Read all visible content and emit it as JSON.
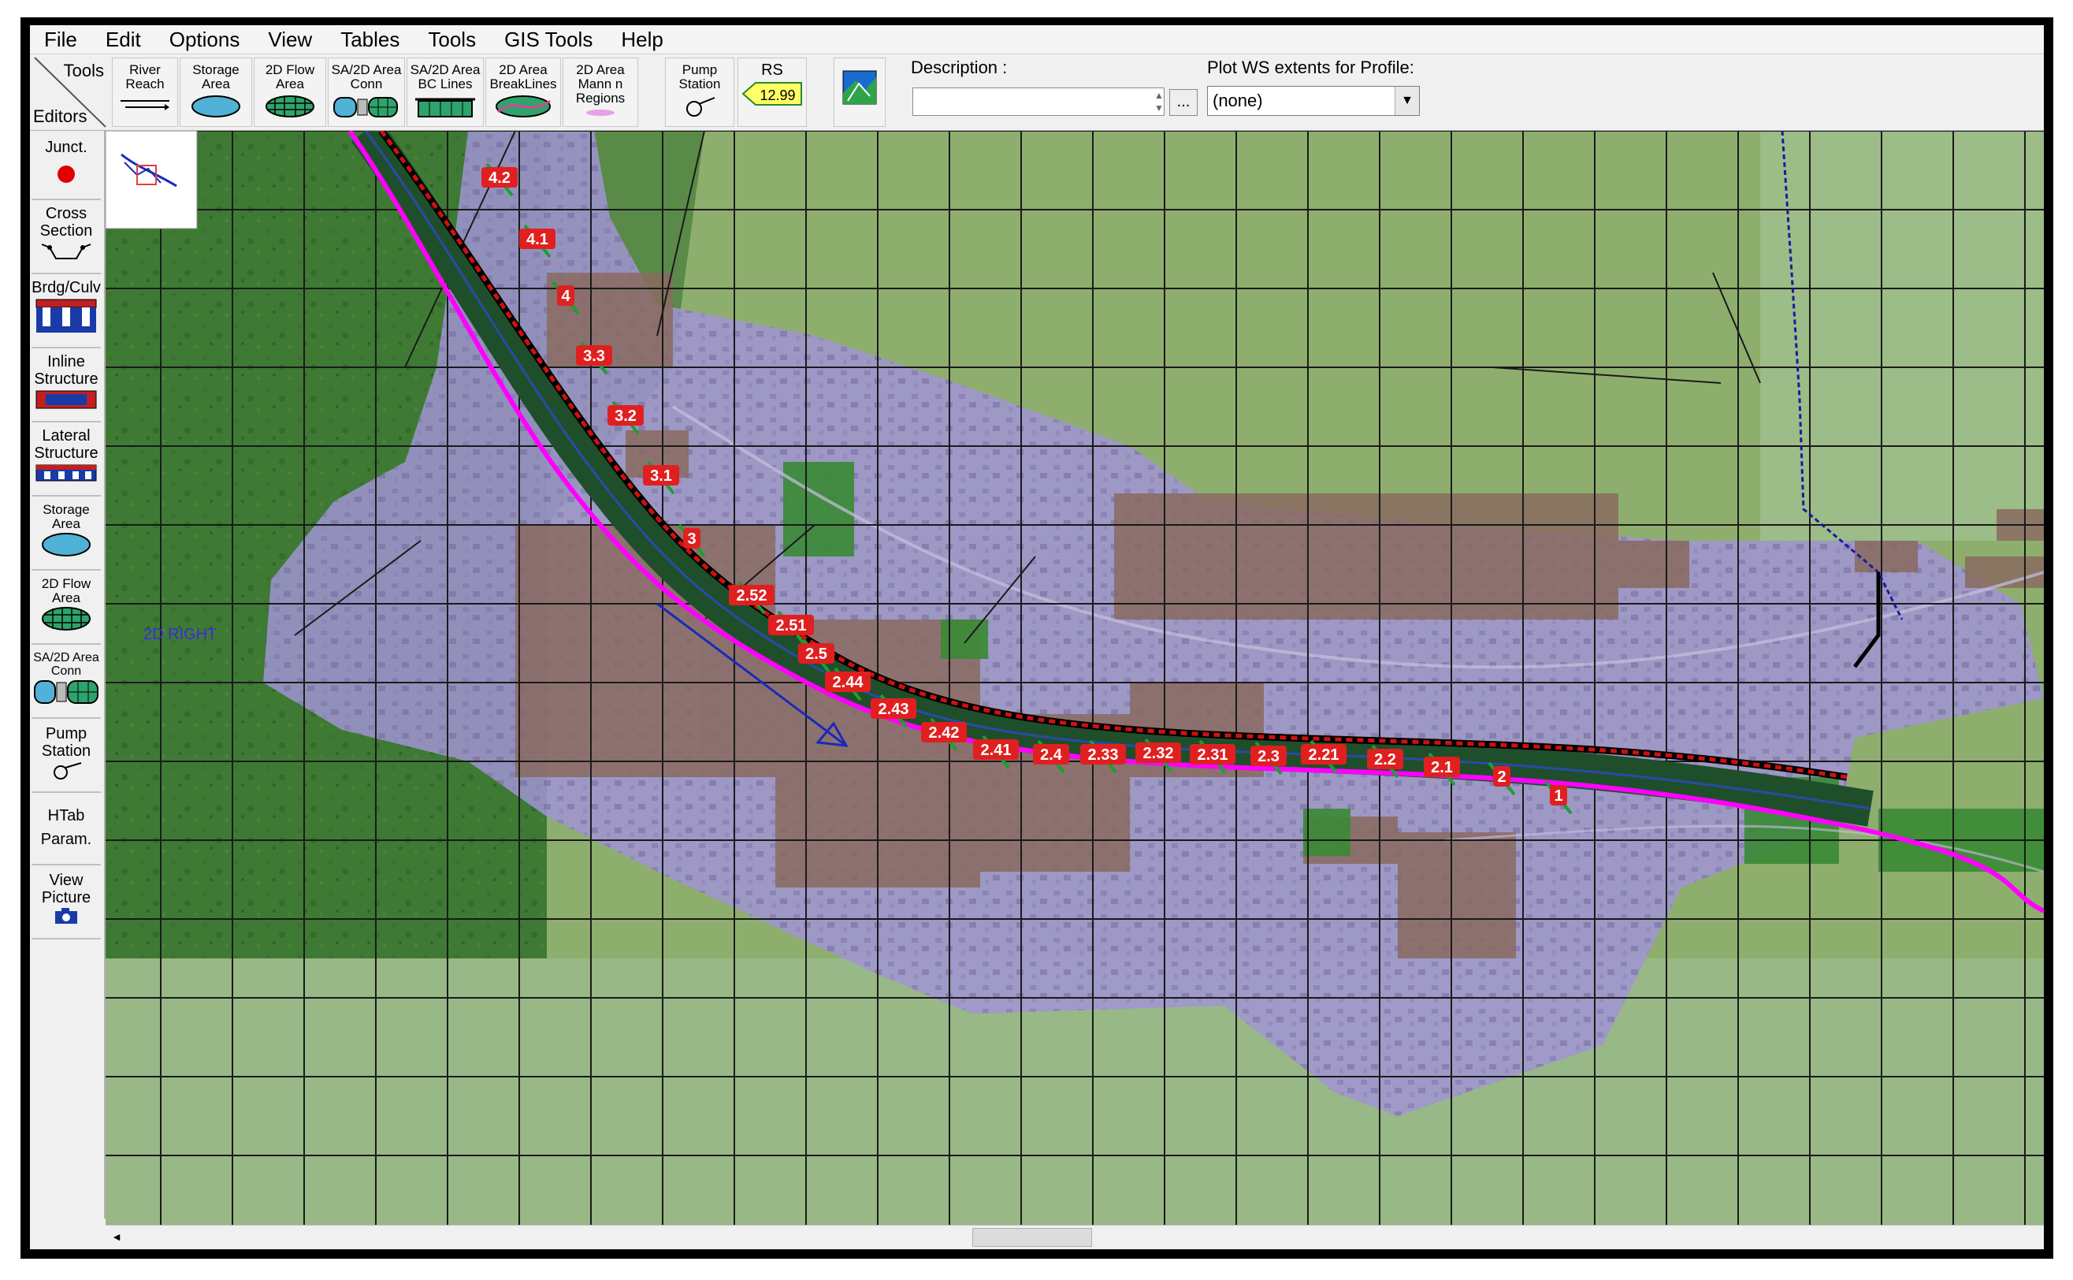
{
  "menu": [
    "File",
    "Edit",
    "Options",
    "View",
    "Tables",
    "Tools",
    "GIS Tools",
    "Help"
  ],
  "toolbar": {
    "corner_tools": "Tools",
    "corner_editors": "Editors",
    "buttons": [
      {
        "l1": "River",
        "l2": "Reach"
      },
      {
        "l1": "Storage",
        "l2": "Area"
      },
      {
        "l1": "2D Flow",
        "l2": "Area"
      },
      {
        "l1": "SA/2D Area",
        "l2": "Conn"
      },
      {
        "l1": "SA/2D Area",
        "l2": "BC Lines"
      },
      {
        "l1": "2D Area",
        "l2": "BreakLines"
      },
      {
        "l1": "2D Area",
        "l2": "Mann n Regions"
      },
      {
        "l1": "Pump",
        "l2": "Station"
      },
      {
        "l1": "RS",
        "l2": "12.99"
      }
    ],
    "description_label": "Description :",
    "description_value": "",
    "dots": "...",
    "plot_label": "Plot WS extents for Profile:",
    "plot_value": "(none)"
  },
  "editors": [
    {
      "l1": "Junct.",
      "l2": ""
    },
    {
      "l1": "Cross",
      "l2": "Section"
    },
    {
      "l1": "Brdg/Culv",
      "l2": ""
    },
    {
      "l1": "Inline",
      "l2": "Structure"
    },
    {
      "l1": "Lateral",
      "l2": "Structure"
    },
    {
      "l1": "Storage",
      "l2": "Area"
    },
    {
      "l1": "2D Flow",
      "l2": "Area"
    },
    {
      "l1": "SA/2D Area",
      "l2": "Conn"
    },
    {
      "l1": "Pump",
      "l2": "Station"
    },
    {
      "l1": "HTab",
      "l2": "Param."
    },
    {
      "l1": "View",
      "l2": "Picture"
    }
  ],
  "map": {
    "area_label": "2D RIGHT",
    "cross_sections": [
      "4.2",
      "4.1",
      "4",
      "3.3",
      "3.2",
      "3.1",
      "3",
      "2.52",
      "2.51",
      "2.5",
      "2.44",
      "2.43",
      "2.42",
      "2.41",
      "2.4",
      "2.33",
      "2.32",
      "2.31",
      "2.3",
      "2.21",
      "2.2",
      "2.1",
      "2",
      "1"
    ]
  },
  "colors": {
    "river": "#ff00ff",
    "levee": "#cc0000",
    "channel": "#1a3a8a",
    "flood": "#9c8fd6"
  }
}
